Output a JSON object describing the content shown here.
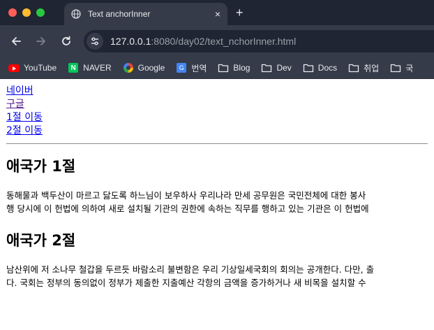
{
  "browser": {
    "tab_title": "Text anchorInner",
    "tab_close": "×",
    "new_tab": "+",
    "url_host": "127.0.0.1",
    "url_rest": ":8080/day02/text_nchorInner.html",
    "bookmarks": [
      {
        "label": "YouTube",
        "icon": "youtube-icon"
      },
      {
        "label": "NAVER",
        "icon": "naver-icon"
      },
      {
        "label": "Google",
        "icon": "google-icon"
      },
      {
        "label": "번역",
        "icon": "translate-icon"
      },
      {
        "label": "Blog",
        "icon": "folder-icon"
      },
      {
        "label": "Dev",
        "icon": "folder-icon"
      },
      {
        "label": "Docs",
        "icon": "folder-icon"
      },
      {
        "label": "취업",
        "icon": "folder-icon"
      },
      {
        "label": "국",
        "icon": "folder-icon"
      }
    ]
  },
  "page": {
    "links": [
      "네이버",
      "구글",
      "1절 이동",
      "2절 이동"
    ],
    "section1": {
      "heading": "애국가 1절",
      "line1": "동해물과 백두산이 마르고 닳도록 하느님이 보우하사 우리나라 만세 공무원은 국민전체에 대한 봉사",
      "line2": "행 당시에 이 헌법에 의하여 새로 설치될 기관의 권한에 속하는 직무를 행하고 있는 기관은 이 헌법에"
    },
    "section2": {
      "heading": "애국가 2절",
      "line1": "남산위에 저 소나무 철갑을 두르듯 바람소리 불변함은 우리 기상일세국회의 회의는 공개한다. 다만, 출",
      "line2": "다. 국회는 정부의 동의없이 정부가 제출한 지출예산 각항의 금액을 증가하거나 새 비목을 설치할 수"
    }
  }
}
